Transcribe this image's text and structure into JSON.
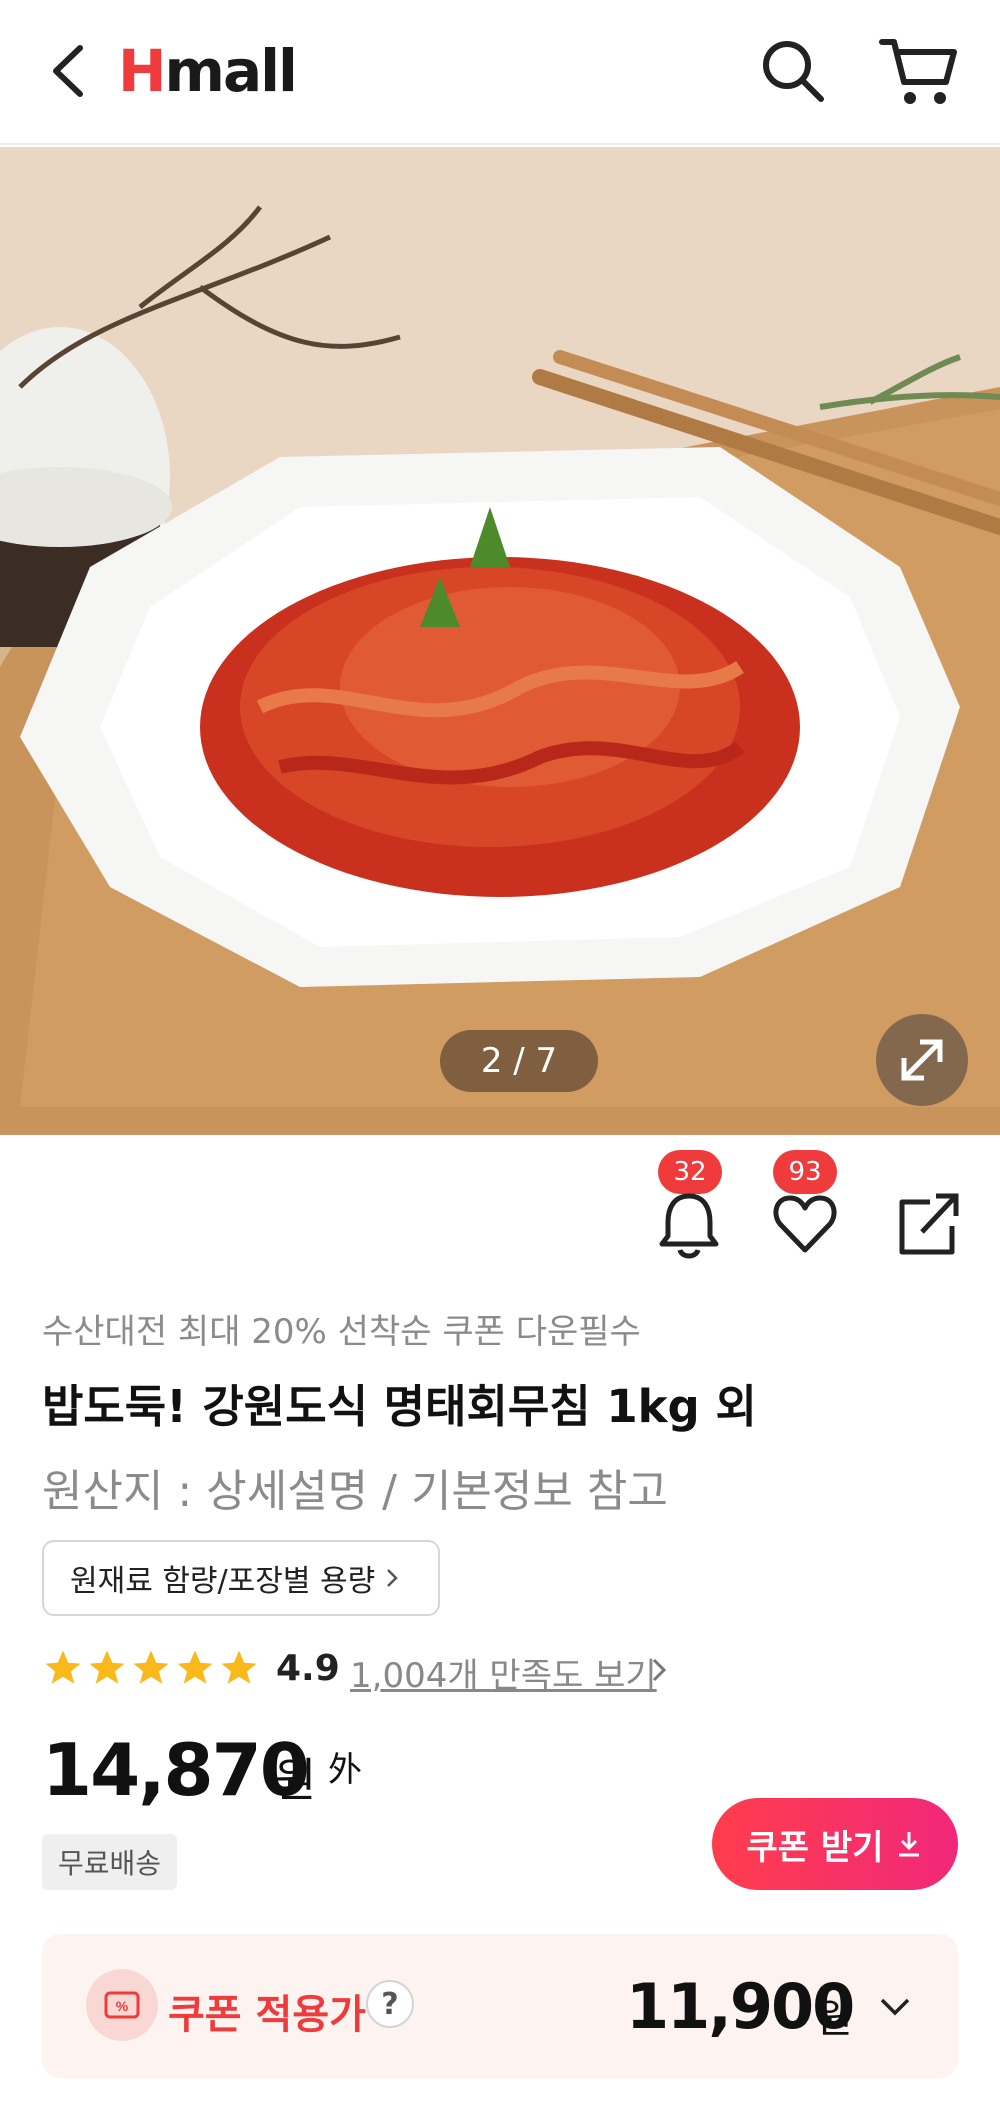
{
  "header": {
    "logo_h": "H",
    "logo_rest": "mall",
    "icons": [
      "back-icon",
      "search-icon",
      "cart-icon"
    ]
  },
  "gallery": {
    "counter": "2 / 7",
    "current": 2,
    "total": 7
  },
  "actions": {
    "alarm_count": "32",
    "like_count": "93"
  },
  "product": {
    "promo": "수산대전 최대 20% 선착순 쿠폰 다운필수",
    "title": "밥도둑! 강원도식 명태회무침 1kg 외",
    "origin": "원산지 : 상세설명 / 기본정보 참고",
    "content_button": "원재료 함량/포장별 용량",
    "rating": "4.9",
    "rating_value": 4.9,
    "reviews_link": "1,004개 만족도 보기",
    "price": "14,870",
    "currency": "원",
    "price_suffix": "外",
    "shipping_badge": "무료배송",
    "coupon_button": "쿠폰 받기"
  },
  "coupon": {
    "label": "쿠폰 적용가",
    "help": "?",
    "price": "11,900",
    "currency": "원"
  },
  "colors": {
    "brand_red": "#ef3b3b",
    "coupon_gradient_start": "#ff3d4d",
    "coupon_gradient_end": "#f0287a",
    "star": "#f9b91b"
  }
}
